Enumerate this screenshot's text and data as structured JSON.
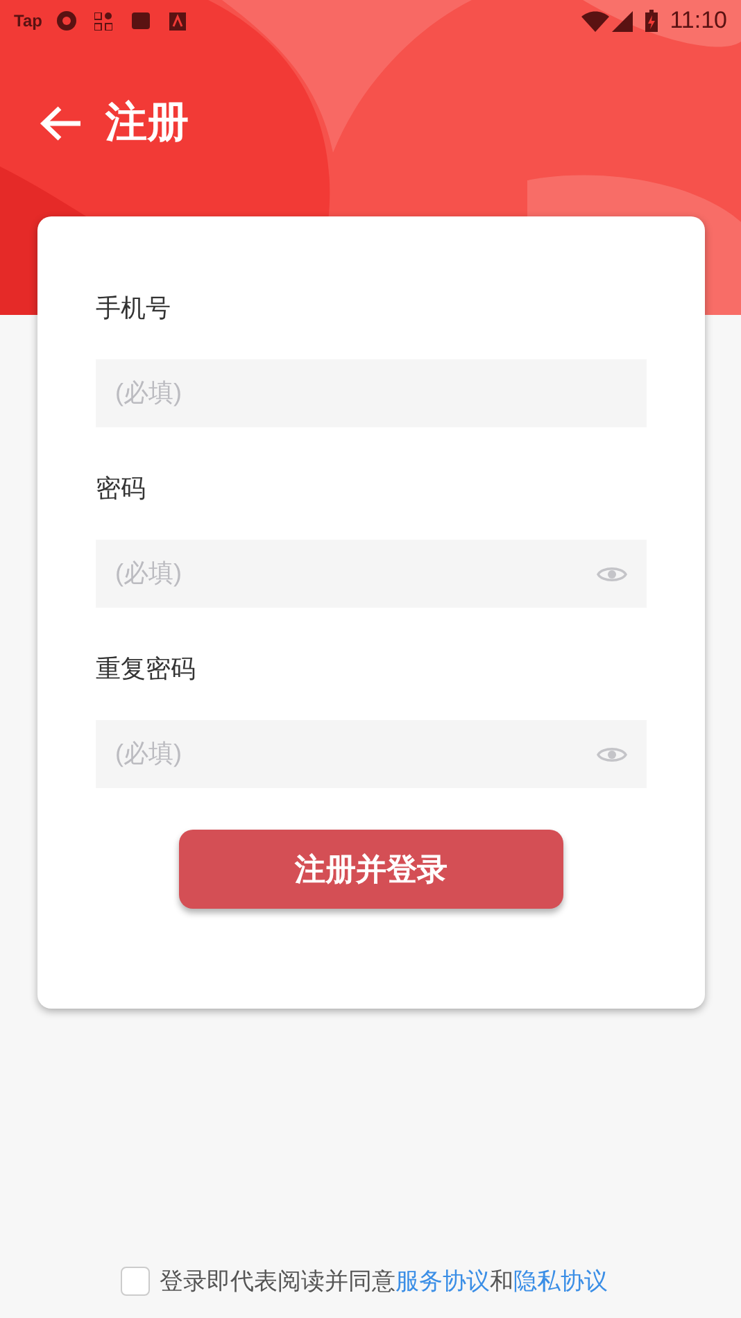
{
  "status_bar": {
    "app_label": "Tap",
    "time": "11:10"
  },
  "header": {
    "title": "注册"
  },
  "form": {
    "fields": [
      {
        "label": "手机号",
        "placeholder": "(必填)",
        "password": false
      },
      {
        "label": "密码",
        "placeholder": "(必填)",
        "password": true
      },
      {
        "label": "重复密码",
        "placeholder": "(必填)",
        "password": true
      }
    ],
    "submit": "注册并登录"
  },
  "agreement": {
    "checked": false,
    "text": "登录即代表阅读并同意",
    "links": [
      "服务协议",
      "隐私协议"
    ],
    "joiner": "和"
  }
}
